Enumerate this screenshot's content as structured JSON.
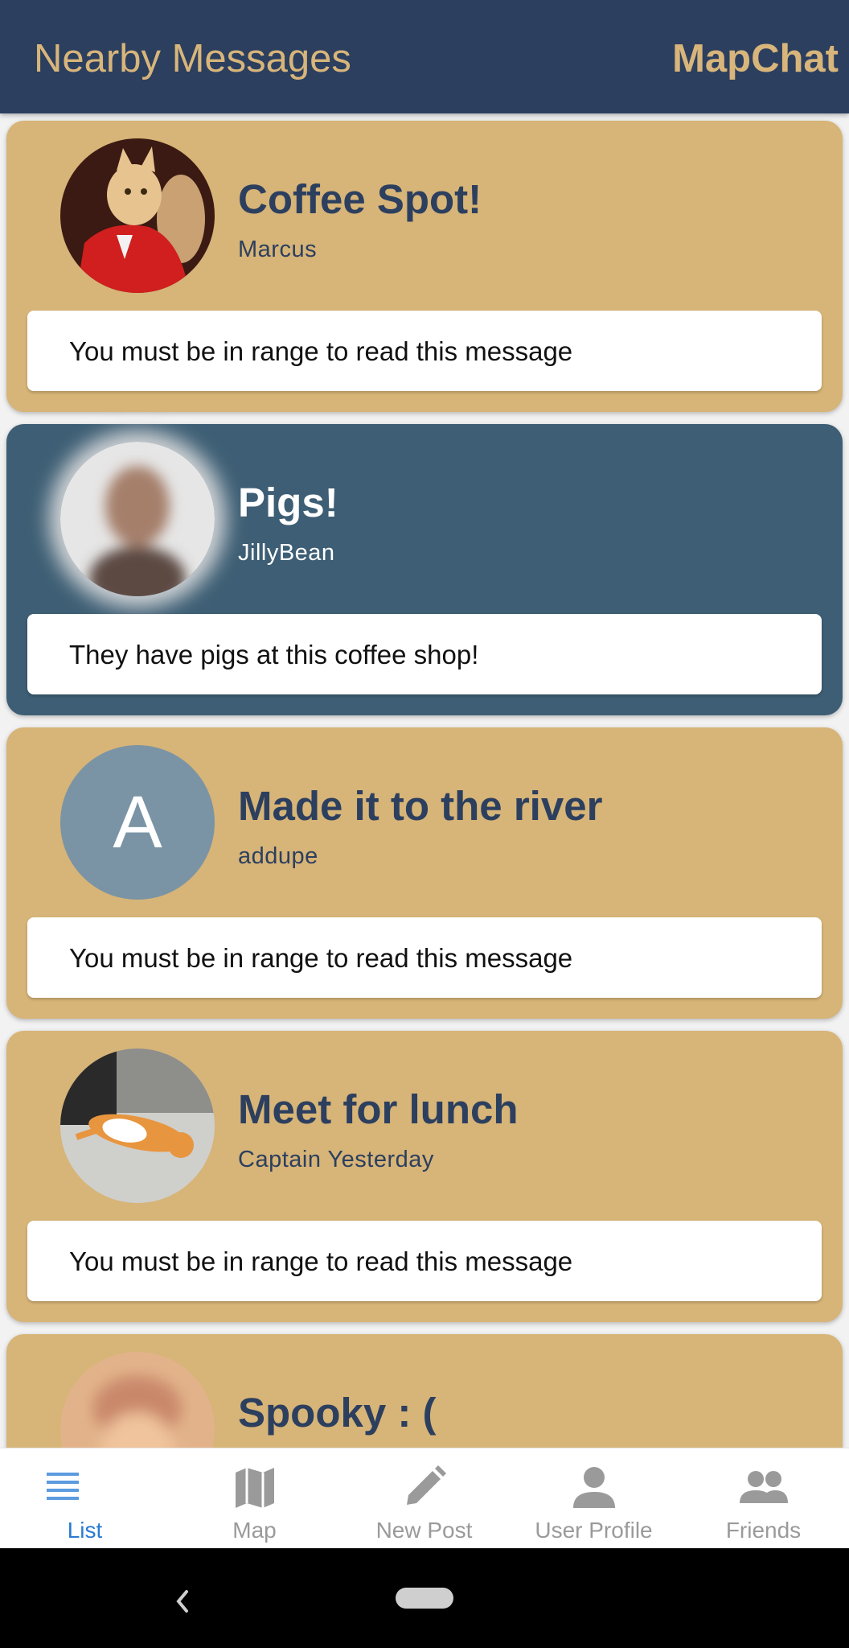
{
  "app_bar": {
    "title": "Nearby Messages",
    "brand": "MapChat"
  },
  "messages": [
    {
      "title": "Coffee Spot!",
      "author": "Marcus",
      "body": "You must be in range to read this message",
      "avatar": "cat-in-red-jacket-avatar"
    },
    {
      "title": "Pigs!",
      "author": "JillyBean",
      "body": "They have pigs at this coffee shop!",
      "avatar": "blurred-person-avatar"
    },
    {
      "title": "Made it to the river",
      "author": "addupe",
      "body": "You must be in range to read this message",
      "avatar_letter": "A"
    },
    {
      "title": "Meet for lunch",
      "author": "Captain Yesterday",
      "body": "You must be in range to read this message",
      "avatar": "sleeping-cat-avatar"
    },
    {
      "title": "Spooky : (",
      "avatar": "blurred-face-avatar"
    }
  ],
  "bottom_nav": [
    {
      "label": "List",
      "icon": "list-icon",
      "selected": true
    },
    {
      "label": "Map",
      "icon": "map-icon"
    },
    {
      "label": "New Post",
      "icon": "pencil-icon"
    },
    {
      "label": "User Profile",
      "icon": "person-icon"
    },
    {
      "label": "Friends",
      "icon": "people-icon"
    }
  ],
  "colors": {
    "app_bar": "#2c3f5f",
    "accent_gold": "#d7b477",
    "active_card": "#3d5e74",
    "nav_selected": "#2a7bd3",
    "nav_inactive": "#9a9a9a"
  }
}
